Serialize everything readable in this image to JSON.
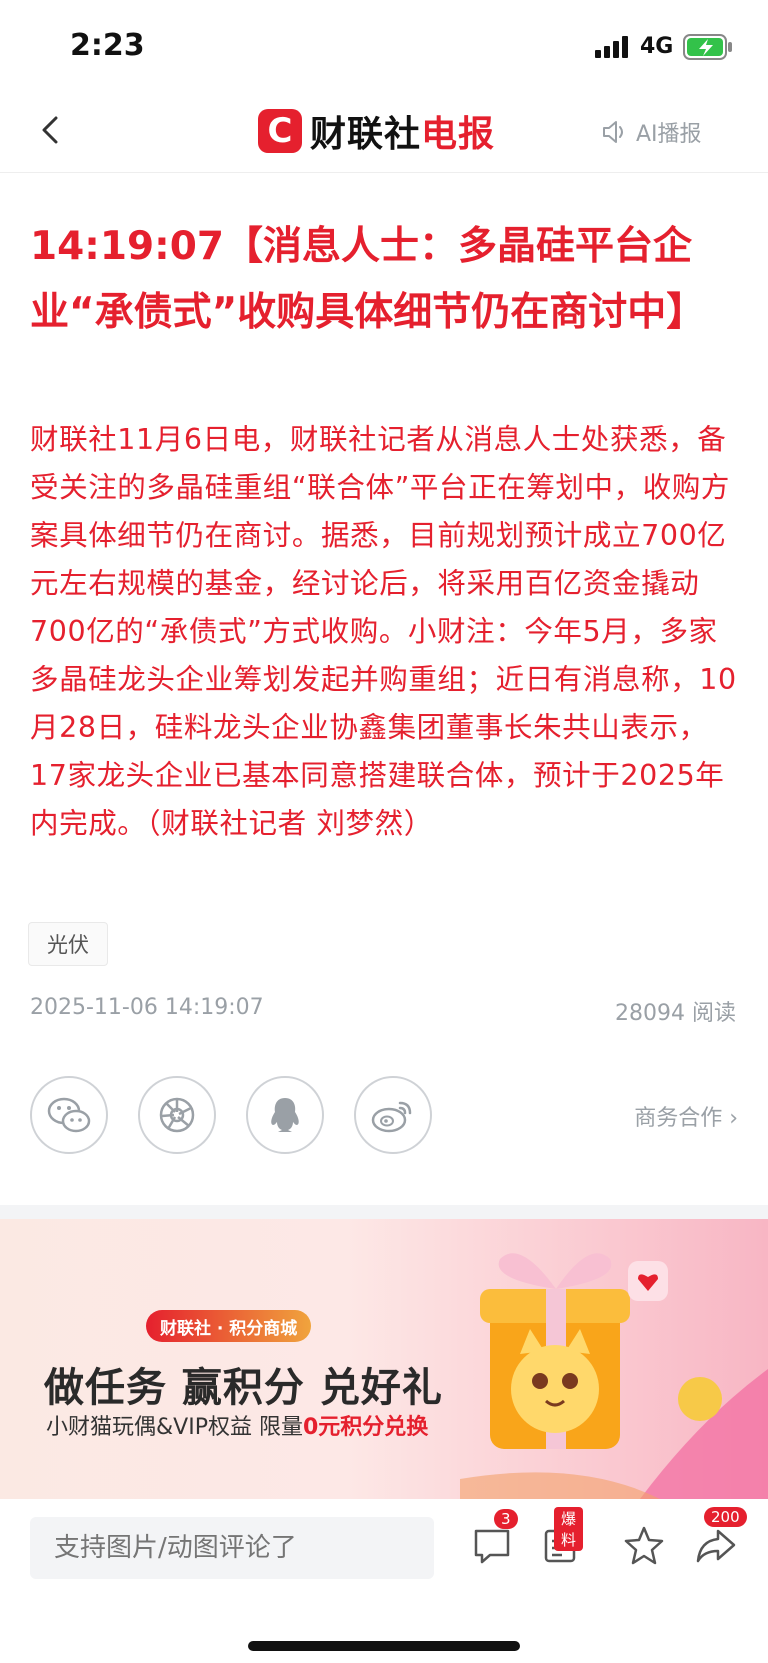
{
  "status_bar": {
    "time": "2:23",
    "network": "4G"
  },
  "nav": {
    "logo_mark": "C",
    "logo_black": "财联社",
    "logo_red": "电报",
    "ai_label": "AI播报"
  },
  "article": {
    "headline": "14:19:07【消息人士：多晶硅平台企业“承债式”收购具体细节仍在商讨中】",
    "body": "财联社11月6日电，财联社记者从消息人士处获悉，备受关注的多晶硅重组“联合体”平台正在筹划中，收购方案具体细节仍在商讨。据悉，目前规划预计成立700亿元左右规模的基金，经讨论后，将采用百亿资金撬动700亿的“承债式”方式收购。小财注：今年5月，多家多晶硅龙头企业筹划发起并购重组；近日有消息称，10月28日，硅料龙头企业协鑫集团董事长朱共山表示，17家龙头企业已基本同意搭建联合体，预计于2025年内完成。（财联社记者 刘梦然）",
    "tag": "光伏",
    "date": "2025-11-06 14:19:07",
    "reads": "28094 阅读"
  },
  "share": {
    "icons": [
      "wechat-icon",
      "moments-icon",
      "qq-icon",
      "weibo-icon"
    ],
    "business_label": "商务合作 ›"
  },
  "banner": {
    "pill": "财联社 · 积分商城",
    "title": "做任务 赢积分 兑好礼",
    "subtitle_prefix": "小财猫玩偶&VIP权益  限量",
    "subtitle_red": "0元积分兑换"
  },
  "bottom_bar": {
    "comment_placeholder": "支持图片/动图评论了",
    "comment_count": "3",
    "report_badge": "爆料",
    "share_count": "200"
  },
  "colors": {
    "accent": "#e5202e",
    "muted": "#9aa0a6"
  }
}
